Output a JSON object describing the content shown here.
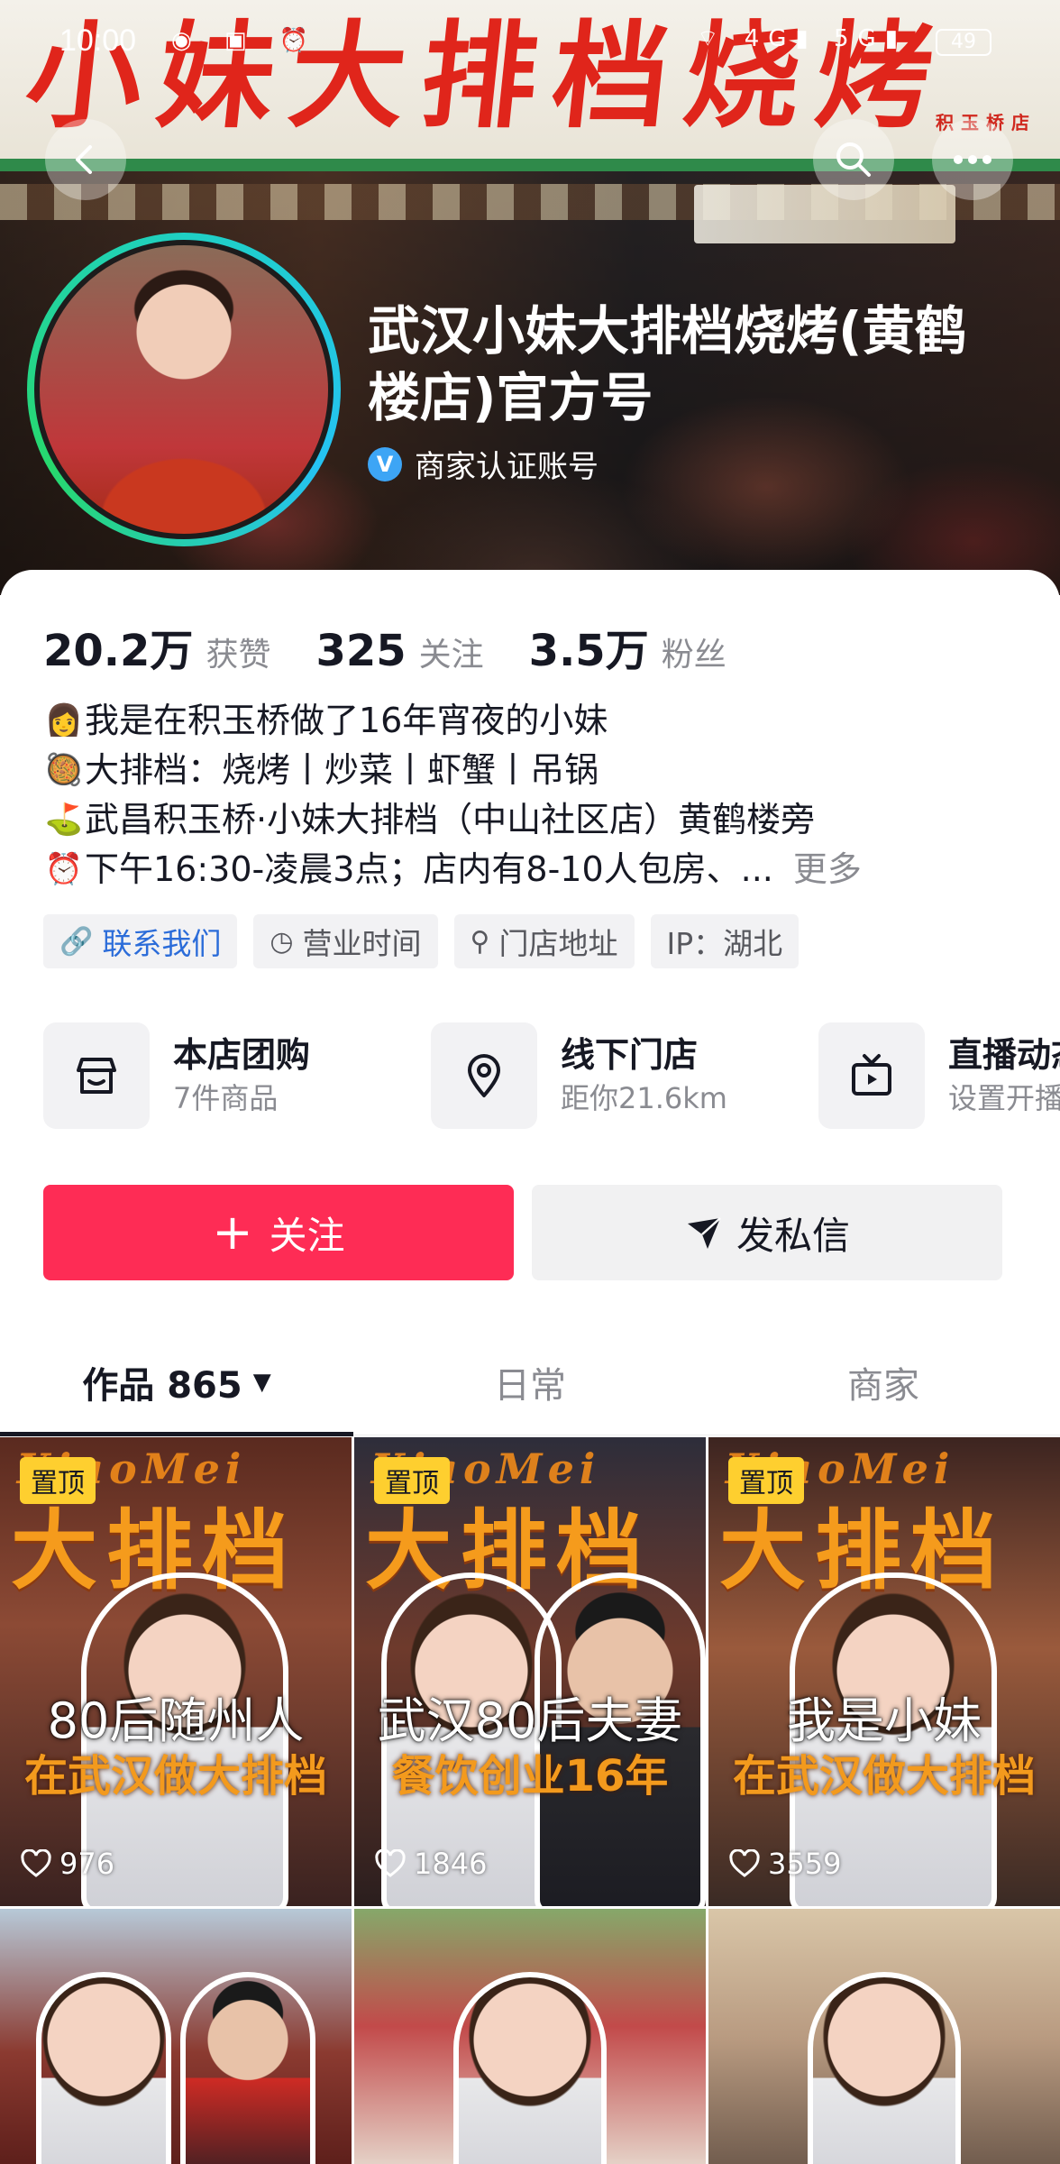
{
  "status_bar": {
    "time": "10:00",
    "battery": "49",
    "net1": "4G",
    "net2": "5G"
  },
  "banner": {
    "sign_text": "小妹大排档烧烤",
    "sign_sub": "积玉桥店"
  },
  "profile": {
    "name": "武汉小妹大排档烧烤(黄鹤楼店)官方号",
    "verified_label": "商家认证账号"
  },
  "stats": [
    {
      "value": "20.2万",
      "label": "获赞"
    },
    {
      "value": "325",
      "label": "关注"
    },
    {
      "value": "3.5万",
      "label": "粉丝"
    }
  ],
  "bio": {
    "lines": [
      {
        "emoji": "👩",
        "text": "我是在积玉桥做了16年宵夜的小妹"
      },
      {
        "emoji": "🥘",
        "text": "大排档：烧烤丨炒菜丨虾蟹丨吊锅"
      },
      {
        "emoji": "⛳",
        "text": "武昌积玉桥·小妹大排档（中山社区店）黄鹤楼旁"
      },
      {
        "emoji": "⏰",
        "text": "下午16:30-凌晨3点；店内有8-10人包房、..."
      }
    ],
    "more_label": "更多"
  },
  "tags": [
    {
      "label": "联系我们",
      "icon": "link-icon"
    },
    {
      "label": "营业时间",
      "icon": "clock-icon"
    },
    {
      "label": "门店地址",
      "icon": "location-icon"
    },
    {
      "label": "IP：湖北",
      "icon": ""
    }
  ],
  "services": [
    {
      "title": "本店团购",
      "subtitle": "7件商品",
      "icon": "shop-icon"
    },
    {
      "title": "线下门店",
      "subtitle": "距你21.6km",
      "icon": "location-pin-icon"
    },
    {
      "title": "直播动态",
      "subtitle": "设置开播",
      "icon": "live-tv-icon"
    }
  ],
  "actions": {
    "follow": "关注",
    "message": "发私信"
  },
  "tabs": [
    {
      "label": "作品 865",
      "active": true
    },
    {
      "label": "日常",
      "active": false
    },
    {
      "label": "商家",
      "active": false
    }
  ],
  "videos": [
    {
      "pinned": "置顶",
      "brand": "XiaoMei",
      "big": "大排档",
      "caption1": "80后随州人",
      "caption2": "在武汉做大排档",
      "likes": "976"
    },
    {
      "pinned": "置顶",
      "brand": "XiaoMei",
      "big": "大排档",
      "caption1": "武汉80后夫妻",
      "caption2": "餐饮创业16年",
      "likes": "1846"
    },
    {
      "pinned": "置顶",
      "brand": "XiaoMei",
      "big": "大排档",
      "caption1": "我是小妹",
      "caption2": "在武汉做大排档",
      "likes": "3559"
    }
  ],
  "colors": {
    "accent": "#fe2c55",
    "pin": "#fecf2f",
    "caption_orange": "#f39a1d"
  }
}
